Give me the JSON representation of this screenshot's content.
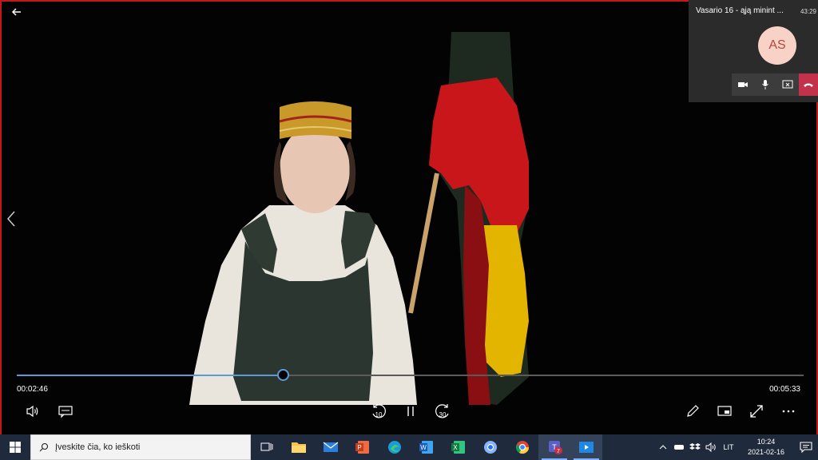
{
  "player": {
    "current_time": "00:02:46",
    "total_time": "00:05:33",
    "progress": 0.338,
    "replay_seconds": "10",
    "forward_seconds": "30"
  },
  "teams": {
    "meeting_title": "Vasario 16 - ąją minint ...",
    "call_time": "43:29",
    "avatar_initials": "AS"
  },
  "taskbar": {
    "search_placeholder": "Įveskite čia, ko ieškoti",
    "apps": [
      "task-view",
      "file-explorer",
      "mail",
      "powerpoint",
      "edge",
      "word",
      "excel",
      "chrome-alt",
      "chrome",
      "teams",
      "video-player"
    ],
    "teams_badge": "7",
    "language": "LIT",
    "time": "10:24",
    "date": "2021-02-16"
  },
  "colors": {
    "accent_progress": "#5b9bd5",
    "frame_border": "#c4161c",
    "hangup": "#c4314b",
    "taskbar": "#1f2a3c"
  }
}
